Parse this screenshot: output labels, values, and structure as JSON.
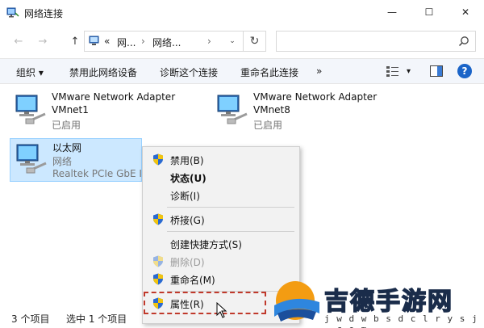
{
  "window": {
    "title": "网络连接",
    "minimize_glyph": "—",
    "maximize_glyph": "☐",
    "close_glyph": "✕"
  },
  "address": {
    "back_glyph": "←",
    "forward_glyph": "→",
    "up_glyph": "↑",
    "crumbs": [
      "«",
      "网...",
      "›",
      "网络...",
      "›"
    ],
    "dropdown_glyph": "⌄",
    "refresh_glyph": "↻",
    "search_placeholder": ""
  },
  "toolbar": {
    "organize": "组织",
    "organize_arrow": "▾",
    "disable": "禁用此网络设备",
    "diagnose": "诊断这个连接",
    "rename": "重命名此连接",
    "more": "»",
    "view_arrow": "▾",
    "help": "?"
  },
  "adapters": [
    {
      "name": "VMware Network Adapter",
      "name2": "VMnet1",
      "status": "已启用"
    },
    {
      "name": "VMware Network Adapter",
      "name2": "VMnet8",
      "status": "已启用"
    },
    {
      "name": "以太网",
      "name2": "网络",
      "status": "Realtek PCIe GbE I"
    }
  ],
  "context_menu": {
    "items": [
      {
        "label": "禁用(B)"
      },
      {
        "label": "状态(U)"
      },
      {
        "label": "诊断(I)"
      },
      {
        "label": "桥接(G)"
      },
      {
        "label": "创建快捷方式(S)"
      },
      {
        "label": "删除(D)"
      },
      {
        "label": "重命名(M)"
      },
      {
        "label": "属性(R)"
      }
    ]
  },
  "statusbar": {
    "items_count": "3 个项目",
    "selected": "选中 1 个项目"
  },
  "watermark": {
    "text": "吉德手游网",
    "url": "j w d w b s d c l r y s j . c o m"
  },
  "colors": {
    "accent": "#0078d7",
    "selection_bg": "#cce8ff",
    "highlight_border": "#c0392b"
  }
}
